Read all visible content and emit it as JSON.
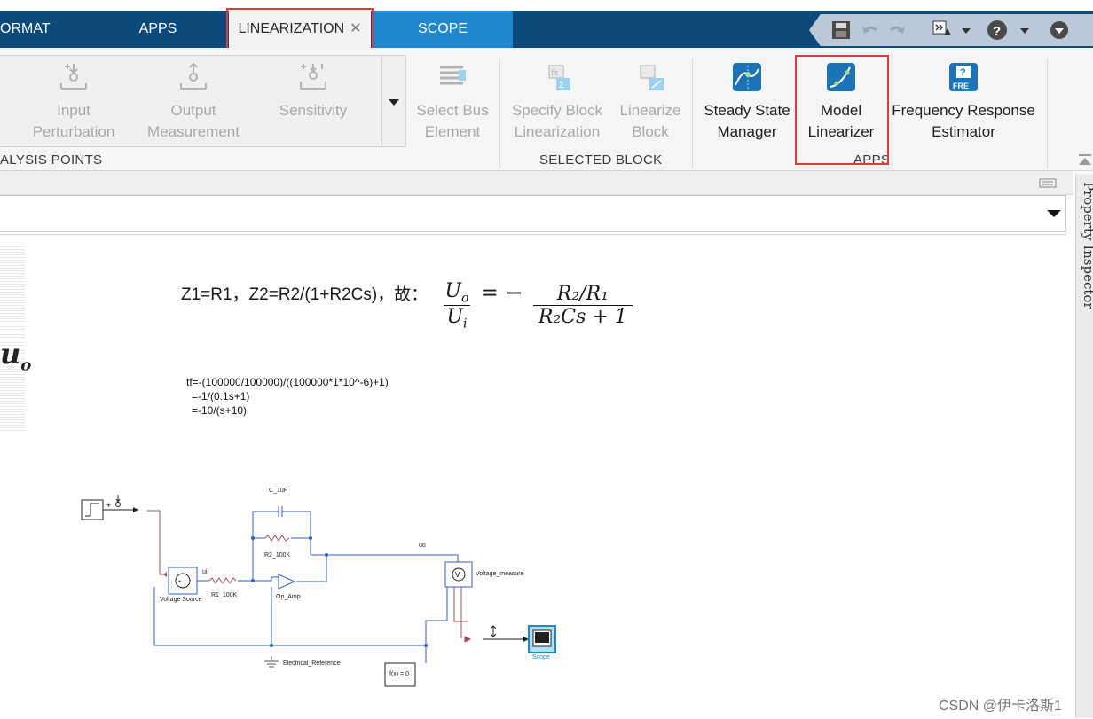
{
  "tabs": [
    {
      "label": "ORMAT"
    },
    {
      "label": "APPS"
    },
    {
      "label": "LINEARIZATION",
      "close": "✕"
    },
    {
      "label": "SCOPE"
    }
  ],
  "quick_access": {
    "icons": [
      "save-icon",
      "undo-icon",
      "redo-icon",
      "shortcut-icon",
      "help-icon",
      "collapse-icon"
    ]
  },
  "ribbon": {
    "analysis_points": {
      "label": "ALYSIS POINTS",
      "buttons": [
        {
          "line1": "Input",
          "line2": "Perturbation"
        },
        {
          "line1": "Output",
          "line2": "Measurement"
        },
        {
          "line1": "Sensitivity",
          "line2": ""
        }
      ]
    },
    "select_bus": {
      "line1": "Select Bus",
      "line2": "Element"
    },
    "selected_block": {
      "label": "SELECTED BLOCK",
      "buttons": [
        {
          "line1": "Specify Block",
          "line2": "Linearization"
        },
        {
          "line1": "Linearize",
          "line2": "Block"
        }
      ]
    },
    "apps": {
      "label": "APPS",
      "buttons": [
        {
          "line1": "Steady State",
          "line2": "Manager"
        },
        {
          "line1": "Model",
          "line2": "Linearizer"
        },
        {
          "line1": "Frequency Response",
          "line2": "Estimator"
        }
      ]
    }
  },
  "side_panel": {
    "label": "Property Inspector"
  },
  "canvas": {
    "formula_prefix": "Z1=R1，Z2=R2/(1+R2Cs)，故：",
    "formula": {
      "num_left": "U",
      "num_left_sub": "o",
      "den_left": "U",
      "den_left_sub": "i",
      "eq": "= −",
      "num_right": "R₂/R₁",
      "den_right": "R₂Cs + 1"
    },
    "partial_symbol": "u",
    "partial_symbol_sub": "o",
    "tf_lines": [
      "tf=-(100000/100000)/((100000*1*10^-6)+1)",
      "=-1/(0.1s+1)",
      "=-10/(s+10)"
    ],
    "blocks": {
      "capacitor": "C_1uF",
      "r2": "R2_100K",
      "r1": "R1_100K",
      "ui": "ui",
      "uo": "uo",
      "voltage_source": "Voltage Source",
      "op_amp": "Op_Amp",
      "voltage_measure": "Voltage_measure",
      "electrical_reference": "Electrical_Reference",
      "scope": "Scope",
      "solver": "f(x) = 0"
    }
  },
  "watermark": "CSDN @伊卡洛斯1",
  "colors": {
    "tabbar": "#0c4a7c",
    "scope_tab": "#1f87cf",
    "highlight": "#e53935",
    "wire_blue": "#3060c0",
    "wire_red": "#a05050"
  }
}
